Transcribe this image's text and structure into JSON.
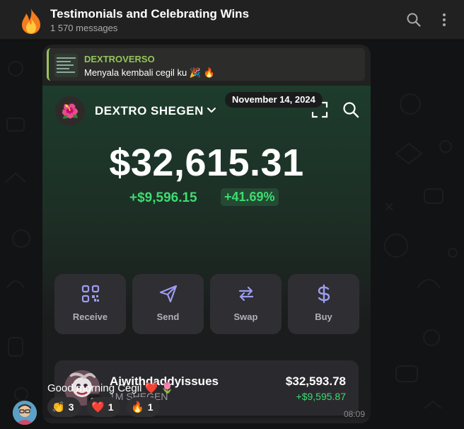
{
  "header": {
    "title": "Testimonials and Celebrating Wins",
    "subtitle": "1 570 messages",
    "avatar_icon": "fire-icon"
  },
  "message": {
    "reply": {
      "name": "DEXTROVERSO",
      "text": "Menyala kembali cegil ku 🎉 🔥"
    },
    "date": "November 14, 2024",
    "caption": "Good morning Cegil ❤️ 🌷",
    "time": "08:09",
    "reactions": [
      {
        "emoji": "👏",
        "count": "3"
      },
      {
        "emoji": "❤️",
        "count": "1"
      },
      {
        "emoji": "🔥",
        "count": "1"
      }
    ]
  },
  "wallet": {
    "name": "DEXTRO SHEGEN",
    "logo": "🌺",
    "balance": "$32,615.31",
    "change": "+$9,596.15",
    "change_pct": "+41.69%",
    "actions": [
      {
        "label": "Receive",
        "icon": "qr-code-icon"
      },
      {
        "label": "Send",
        "icon": "send-icon"
      },
      {
        "label": "Swap",
        "icon": "swap-icon"
      },
      {
        "label": "Buy",
        "icon": "dollar-icon"
      }
    ],
    "token": {
      "name": "Aiwithdaddyissues",
      "amount": "1M SHEGEN",
      "value": "$32,593.78",
      "change": "+$9,595.87"
    }
  },
  "colors": {
    "accent_green": "#3ddc71",
    "reply_green": "#95c45c",
    "bubble": "#212121",
    "action_tile": "#2e2e33"
  }
}
